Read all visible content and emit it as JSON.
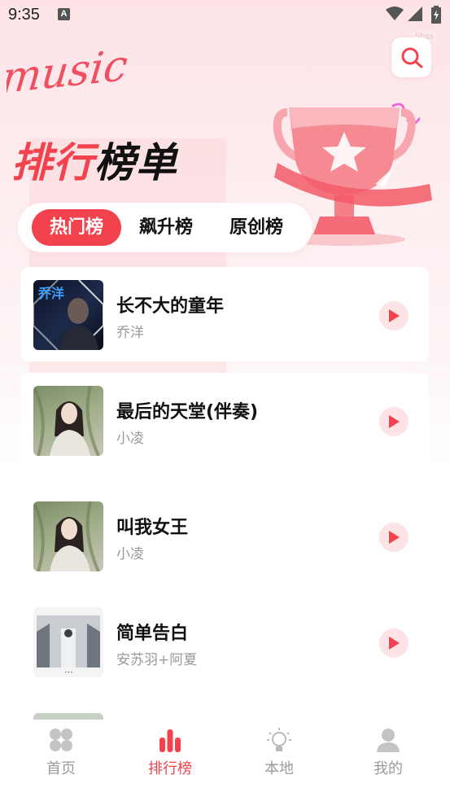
{
  "status_bar": {
    "time": "9:35",
    "notification_glyph": "A"
  },
  "watermark": "5hss",
  "brand": {
    "logo_text": "music"
  },
  "header": {
    "title_part1": "排行",
    "title_part2": "榜单"
  },
  "tabs": [
    {
      "label": "热门榜",
      "active": true
    },
    {
      "label": "飙升榜",
      "active": false
    },
    {
      "label": "原创榜",
      "active": false
    }
  ],
  "songs": [
    {
      "title": "长不大的童年",
      "artist": "乔洋",
      "cover_text": "乔洋"
    },
    {
      "title": "最后的天堂(伴奏)",
      "artist": "小凌"
    },
    {
      "title": "叫我女王",
      "artist": "小凌"
    },
    {
      "title": "简单告白",
      "artist": "安苏羽+阿夏"
    }
  ],
  "bottom_nav": [
    {
      "label": "首页",
      "icon": "home-grid-icon",
      "active": false
    },
    {
      "label": "排行榜",
      "icon": "bar-chart-icon",
      "active": true
    },
    {
      "label": "本地",
      "icon": "lightbulb-icon",
      "active": false
    },
    {
      "label": "我的",
      "icon": "user-icon",
      "active": false
    }
  ],
  "colors": {
    "accent": "#f2424e",
    "accent_light": "#fde3e5",
    "text_secondary": "#9a9a9a"
  }
}
